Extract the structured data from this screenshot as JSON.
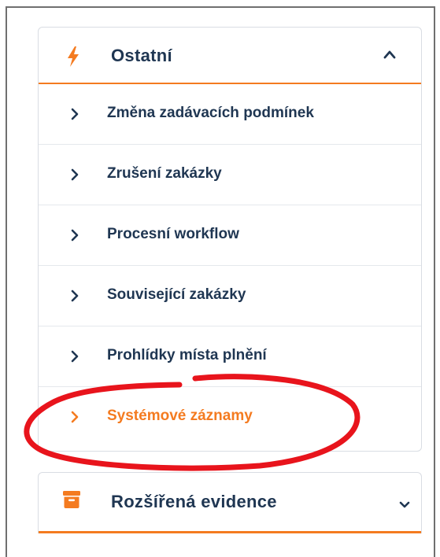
{
  "panel_ostatni": {
    "title": "Ostatní",
    "icon": "bolt-icon",
    "expanded": true,
    "items": [
      {
        "label": "Změna zadávacích podmínek",
        "active": false
      },
      {
        "label": "Zrušení zakázky",
        "active": false
      },
      {
        "label": "Procesní workflow",
        "active": false
      },
      {
        "label": "Související zakázky",
        "active": false
      },
      {
        "label": "Prohlídky místa plnění",
        "active": false
      },
      {
        "label": "Systémové záznamy",
        "active": true
      }
    ]
  },
  "panel_rozsirena": {
    "title": "Rozšířená evidence",
    "icon": "archive-icon",
    "expanded": false
  },
  "colors": {
    "accent": "#f47b20",
    "text": "#1f3652",
    "annotation": "#e8141c"
  }
}
